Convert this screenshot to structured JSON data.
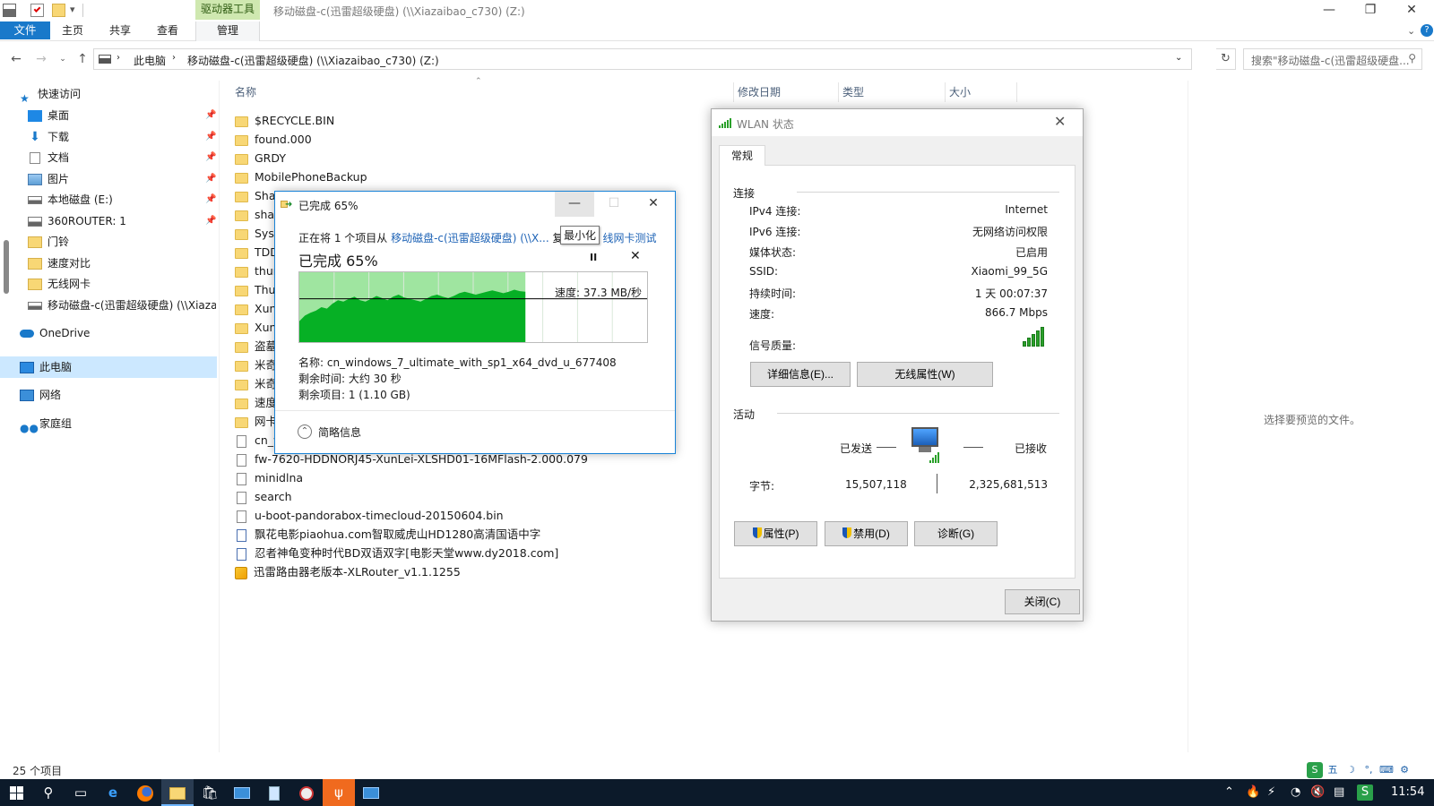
{
  "title_bar": {
    "tools_tab": "驱动器工具",
    "window_title": "移动磁盘-c(迅雷超级硬盘) (\\\\Xiazaibao_c730) (Z:)",
    "minimize": "—",
    "maximize": "❐",
    "close": "✕"
  },
  "ribbon": {
    "tabs": [
      "文件",
      "主页",
      "共享",
      "查看",
      "管理"
    ]
  },
  "address": {
    "breadcrumbs": [
      "此电脑",
      "移动磁盘-c(迅雷超级硬盘) (\\\\Xiazaibao_c730) (Z:)"
    ],
    "search_placeholder": "搜索\"移动磁盘-c(迅雷超级硬盘...",
    "refresh": "↻"
  },
  "nav": {
    "quick_access": "快速访问",
    "items": [
      "桌面",
      "下载",
      "文档",
      "图片",
      "本地磁盘 (E:)",
      "360ROUTER: 1",
      "门铃",
      "速度对比",
      "无线网卡",
      "移动磁盘-c(迅雷超级硬盘) (\\\\Xiaza"
    ],
    "onedrive": "OneDrive",
    "this_pc": "此电脑",
    "network": "网络",
    "homegroup": "家庭组"
  },
  "columns": {
    "name": "名称",
    "modified": "修改日期",
    "type": "类型",
    "size": "大小"
  },
  "files": [
    {
      "name": "$RECYCLE.BIN",
      "kind": "folder"
    },
    {
      "name": "found.000",
      "kind": "folder"
    },
    {
      "name": "GRDY",
      "kind": "folder"
    },
    {
      "name": "MobilePhoneBackup",
      "kind": "folder"
    },
    {
      "name": "Shar",
      "kind": "folder"
    },
    {
      "name": "shar",
      "kind": "folder"
    },
    {
      "name": "Syst",
      "kind": "folder"
    },
    {
      "name": "TDD",
      "kind": "folder"
    },
    {
      "name": "thun",
      "kind": "folder"
    },
    {
      "name": "Thur",
      "kind": "folder"
    },
    {
      "name": "Xunl",
      "kind": "folder"
    },
    {
      "name": "Xunl",
      "kind": "folder"
    },
    {
      "name": "盗墓",
      "kind": "folder"
    },
    {
      "name": "米奇",
      "kind": "folder"
    },
    {
      "name": "米奇",
      "kind": "folder"
    },
    {
      "name": "速度",
      "kind": "folder"
    },
    {
      "name": "网卡",
      "kind": "folder"
    },
    {
      "name": "cn_w",
      "kind": "doc"
    },
    {
      "name": "fw-7620-HDDNORJ45-XunLei-XLSHD01-16MFlash-2.000.079",
      "kind": "doc"
    },
    {
      "name": "minidlna",
      "kind": "doc"
    },
    {
      "name": "search",
      "kind": "doc"
    },
    {
      "name": "u-boot-pandorabox-timecloud-20150604.bin",
      "kind": "doc"
    },
    {
      "name": "飘花电影piaohua.com智取威虎山HD1280高清国语中字",
      "kind": "video"
    },
    {
      "name": "忍者神龟变种时代BD双语双字[电影天堂www.dy2018.com]",
      "kind": "video"
    },
    {
      "name": "迅雷路由器老版本-XLRouter_v1.1.1255",
      "kind": "exe"
    }
  ],
  "preview_text": "选择要预览的文件。",
  "status": {
    "item_count": "25 个项目"
  },
  "copy_dialog": {
    "title": "已完成 65%",
    "line_prefix": "正在将 1 个项目从 ",
    "source_link": "移动磁盘-c(迅雷超级硬盘) (\\\\X...",
    "line_mid": " 复",
    "dest_link": "线网卡测试",
    "tooltip": "最小化",
    "progress_text": "已完成 65%",
    "progress": 0.65,
    "pause": "II",
    "stop": "✕",
    "speed": "速度: 37.3 MB/秒",
    "name_line": "名称: cn_windows_7_ultimate_with_sp1_x64_dvd_u_677408",
    "time_line": "剩余时间: 大约 30 秒",
    "items_line": "剩余项目: 1 (1.10 GB)",
    "details_toggle": "简略信息",
    "speed_history": [
      0.3,
      0.38,
      0.42,
      0.45,
      0.5,
      0.48,
      0.55,
      0.6,
      0.58,
      0.62,
      0.65,
      0.6,
      0.58,
      0.62,
      0.66,
      0.63,
      0.6,
      0.65,
      0.68,
      0.64,
      0.62,
      0.6,
      0.58,
      0.62,
      0.66,
      0.68,
      0.65,
      0.63,
      0.66,
      0.7,
      0.72,
      0.7,
      0.68,
      0.7,
      0.72,
      0.74,
      0.72,
      0.7,
      0.72,
      0.75,
      0.73,
      0.72
    ],
    "speed_level": 0.62,
    "accent": "#06b025"
  },
  "wlan": {
    "title": "WLAN 状态",
    "tab": "常规",
    "connection_heading": "连接",
    "rows": [
      {
        "label": "IPv4 连接:",
        "value": "Internet"
      },
      {
        "label": "IPv6 连接:",
        "value": "无网络访问权限"
      },
      {
        "label": "媒体状态:",
        "value": "已启用"
      },
      {
        "label": "SSID:",
        "value": "Xiaomi_99_5G"
      },
      {
        "label": "持续时间:",
        "value": "1 天 00:07:37"
      },
      {
        "label": "速度:",
        "value": "866.7 Mbps"
      }
    ],
    "signal_label": "信号质量:",
    "signal_bars": 5,
    "details_btn": "详细信息(E)...",
    "wireless_props_btn": "无线属性(W)",
    "activity_heading": "活动",
    "sent_label": "已发送",
    "received_label": "已接收",
    "bytes_label": "字节:",
    "bytes_sent": "15,507,118",
    "bytes_received": "2,325,681,513",
    "properties_btn": "属性(P)",
    "disable_btn": "禁用(D)",
    "diagnose_btn": "诊断(G)",
    "close_btn": "关闭(C)"
  },
  "taskbar": {
    "clock": "11:54",
    "tray_ime": [
      "S",
      "五",
      "☽",
      "°,",
      "⌨",
      "⚙"
    ]
  }
}
